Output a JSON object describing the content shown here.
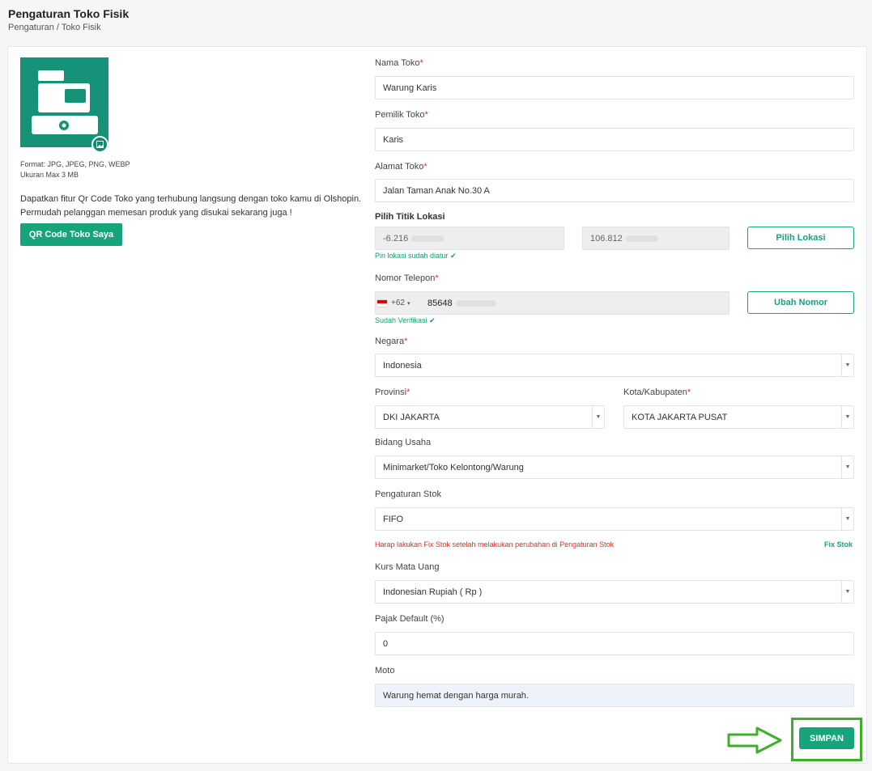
{
  "header": {
    "title": "Pengaturan Toko Fisik",
    "breadcrumb": "Pengaturan / Toko Fisik"
  },
  "left": {
    "image_format": "Format: JPG, JPEG, PNG, WEBP",
    "image_size": "Ukuran Max 3 MB",
    "qr_description": "Dapatkan fitur Qr Code Toko yang terhubung langsung dengan toko kamu di Olshopin. Permudah pelanggan memesan produk yang disukai sekarang juga !",
    "qr_button": "QR Code Toko Saya"
  },
  "form": {
    "store_name": {
      "label": "Nama Toko",
      "value": "Warung Karis"
    },
    "owner": {
      "label": "Pemilik Toko",
      "value": "Karis"
    },
    "address": {
      "label": "Alamat Toko",
      "value": "Jalan Taman Anak No.30 A"
    },
    "location": {
      "label": "Pilih Titik Lokasi",
      "lat": "-6.216",
      "lng": "106.812",
      "button": "Pilih Lokasi",
      "status": "Pin lokasi sudah diatur"
    },
    "phone": {
      "label": "Nomor Telepon",
      "code": "+62",
      "number": "85648",
      "button": "Ubah Nomor",
      "status": "Sudah Verifikasi"
    },
    "country": {
      "label": "Negara",
      "value": "Indonesia"
    },
    "province": {
      "label": "Provinsi",
      "value": "DKI JAKARTA"
    },
    "city": {
      "label": "Kota/Kabupaten",
      "value": "KOTA JAKARTA PUSAT"
    },
    "business": {
      "label": "Bidang Usaha",
      "value": "Minimarket/Toko Kelontong/Warung"
    },
    "stock": {
      "label": "Pengaturan Stok",
      "value": "FIFO",
      "warning": "Harap lakukan Fix Stok setelah melakukan perubahan di Pengaturan Stok",
      "fix_link": "Fix Stok"
    },
    "currency": {
      "label": "Kurs Mata Uang",
      "value": "Indonesian Rupiah ( Rp )"
    },
    "tax": {
      "label": "Pajak Default (%)",
      "value": "0"
    },
    "motto": {
      "label": "Moto",
      "value": "Warung hemat dengan harga murah."
    },
    "required_mark": "*",
    "save_button": "SIMPAN"
  },
  "colors": {
    "primary": "#17a47c",
    "image_bg": "#159278",
    "error": "#d93025",
    "highlight": "#3fae2a"
  },
  "icons": {
    "image_edit": "image-icon",
    "check": "check-icon",
    "select": "chevron-down-icon",
    "annotation": "arrow-right-icon"
  }
}
